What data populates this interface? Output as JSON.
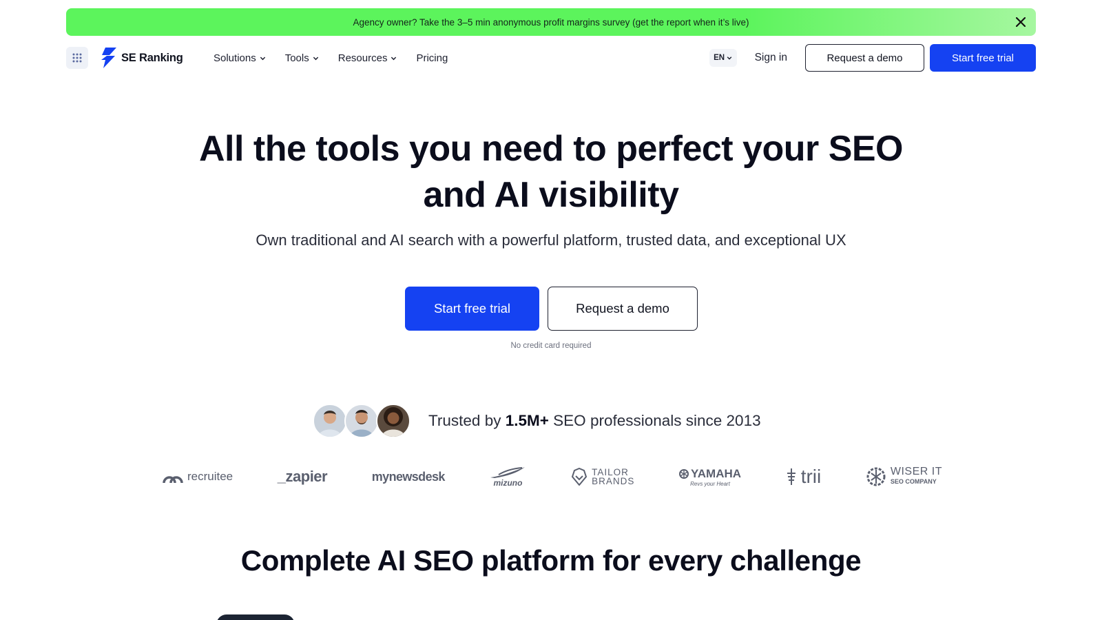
{
  "banner": {
    "text": "Agency owner? Take the 3–5 min anonymous profit margins survey (get the report when it’s live)",
    "close_icon": "close-icon",
    "color": "#5cf45c"
  },
  "nav": {
    "logo_text": "SE Ranking",
    "menu": [
      {
        "label": "Solutions",
        "has_dropdown": true
      },
      {
        "label": "Tools",
        "has_dropdown": true
      },
      {
        "label": "Resources",
        "has_dropdown": true
      },
      {
        "label": "Pricing",
        "has_dropdown": false
      }
    ],
    "language": "EN",
    "sign_in": "Sign in",
    "request_demo": "Request a demo",
    "start_trial": "Start free trial"
  },
  "hero": {
    "title_line1": "All the tools you need to perfect your SEO",
    "title_line2": "and AI visibility",
    "subtitle": "Own traditional and AI search with a powerful platform, trusted data, and exceptional UX",
    "cta_primary": "Start free trial",
    "cta_secondary": "Request a demo",
    "note": "No credit card required"
  },
  "trust": {
    "prefix": "Trusted by",
    "number": "1.5M+",
    "suffix": "SEO professionals since 2013"
  },
  "brands": [
    {
      "name": "recruitee",
      "icon": "recruitee-logo"
    },
    {
      "name": "_zapier",
      "icon": "zapier-logo"
    },
    {
      "name": "mynewsdesk",
      "icon": "mynewsdesk-logo"
    },
    {
      "name": "mizuno",
      "icon": "mizuno-logo"
    },
    {
      "name": "TAILOR",
      "sub": "BRANDS",
      "icon": "tailor-brands-logo"
    },
    {
      "name": "YAMAHA",
      "sub": "Revs your Heart",
      "icon": "yamaha-logo"
    },
    {
      "name": "trii",
      "icon": "trii-logo"
    },
    {
      "name": "WISER IT",
      "sub": "SEO COMPANY",
      "icon": "wiser-it-logo"
    }
  ],
  "section": {
    "title": "Complete AI SEO platform for every challenge"
  },
  "colors": {
    "primary": "#1542f2",
    "text": "#0b0d1c",
    "banner": "#5cf45c"
  }
}
